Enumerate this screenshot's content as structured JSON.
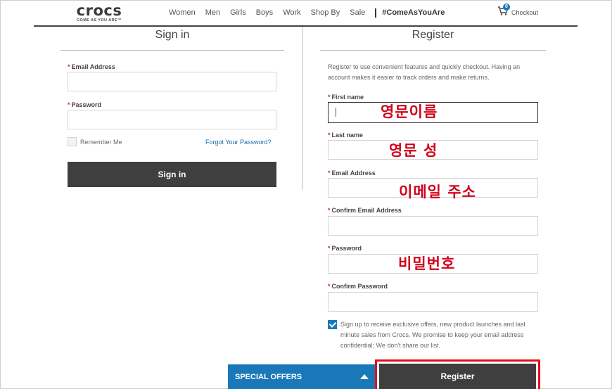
{
  "header": {
    "logo_word": "crocs",
    "logo_tagline": "COME AS YOU ARE™",
    "nav": [
      "Women",
      "Men",
      "Girls",
      "Boys",
      "Work",
      "Shop By",
      "Sale"
    ],
    "hashtag": "#ComeAsYouAre",
    "checkout_label": "Checkout",
    "cart_count": "0"
  },
  "signin": {
    "title": "Sign in",
    "email_label": "Email Address",
    "password_label": "Password",
    "email_value": "",
    "password_value": "",
    "remember_label": "Remember Me",
    "forgot_link": "Forgot Your Password?",
    "button_label": "Sign in",
    "required_mark": "*"
  },
  "register": {
    "title": "Register",
    "description": "Register to use convenient features and quickly checkout. Having an account makes it easier to track orders and make returns.",
    "first_name_label": "First name",
    "last_name_label": "Last name",
    "email_label": "Email Address",
    "confirm_email_label": "Confirm Email Address",
    "password_label": "Password",
    "confirm_password_label": "Confirm Password",
    "offers_text": "Sign up to receive exclusive offers, new product launches and last minute sales from Crocs. We promise to keep your email address confidential; We don't share our list.",
    "offers_checked": true,
    "button_label": "Register"
  },
  "annotations": {
    "first_name": "영문이름",
    "last_name": "영문 성",
    "email": "이메일 주소",
    "password": "비밀번호"
  },
  "footer": {
    "special_offers_label": "SPECIAL OFFERS"
  },
  "colors": {
    "accent_blue": "#1a78b8",
    "button_dark": "#3f3f3f",
    "annotation_red": "#d0021b"
  }
}
